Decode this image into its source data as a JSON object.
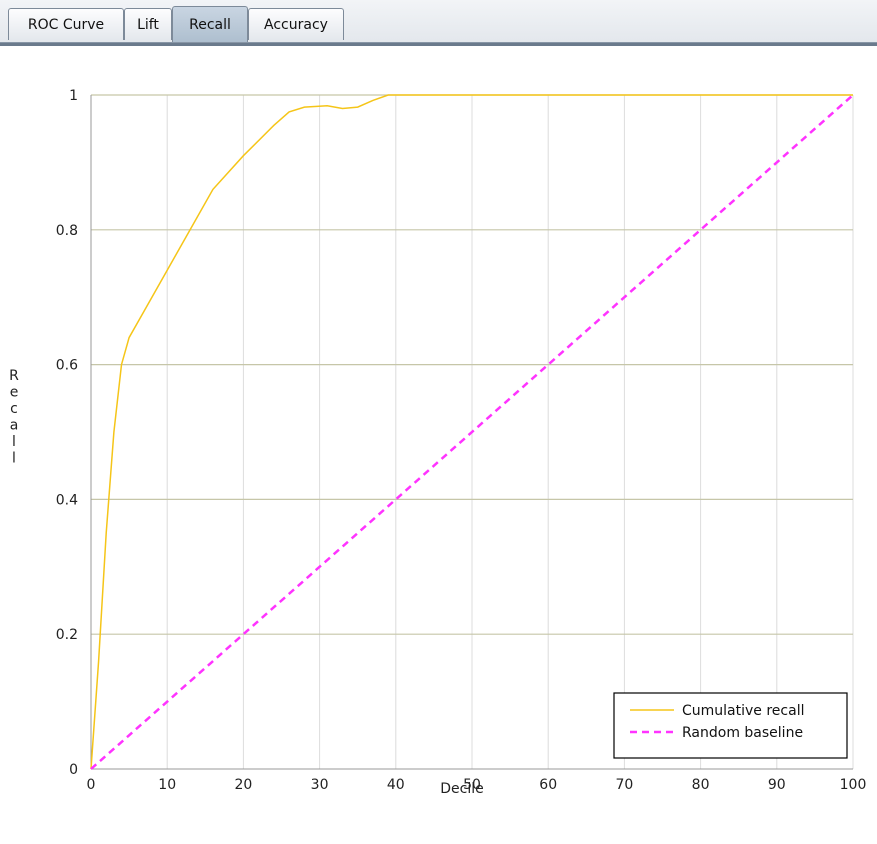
{
  "tabs": [
    {
      "label": "ROC Curve",
      "selected": false
    },
    {
      "label": "Lift",
      "selected": false
    },
    {
      "label": "Recall",
      "selected": true
    },
    {
      "label": "Accuracy",
      "selected": false
    }
  ],
  "chart_data": {
    "type": "line",
    "xlabel": "Decile",
    "ylabel": "Recall",
    "xlim": [
      0,
      100
    ],
    "ylim": [
      0,
      1
    ],
    "xticks": [
      0,
      10,
      20,
      30,
      40,
      50,
      60,
      70,
      80,
      90,
      100
    ],
    "yticks": [
      0,
      0.2,
      0.4,
      0.6,
      0.8,
      1
    ],
    "ytick_labels": [
      "0",
      "0.2",
      "0.4",
      "0.6",
      "0.8",
      "1"
    ],
    "grid": true,
    "legend_position": "bottom-right",
    "series": [
      {
        "name": "Cumulative recall",
        "color": "#f5c518",
        "style": "solid",
        "x": [
          0,
          1,
          2,
          3,
          4,
          5,
          7,
          10,
          13,
          16,
          20,
          24,
          26,
          28,
          31,
          33,
          35,
          37,
          39,
          40,
          100
        ],
        "y": [
          0,
          0.16,
          0.35,
          0.5,
          0.6,
          0.64,
          0.68,
          0.74,
          0.8,
          0.86,
          0.91,
          0.955,
          0.975,
          0.982,
          0.984,
          0.98,
          0.982,
          0.992,
          1.0,
          1.0,
          1.0
        ]
      },
      {
        "name": "Random baseline",
        "color": "#ff33ff",
        "style": "dashed",
        "x": [
          0,
          100
        ],
        "y": [
          0,
          1
        ]
      }
    ]
  }
}
